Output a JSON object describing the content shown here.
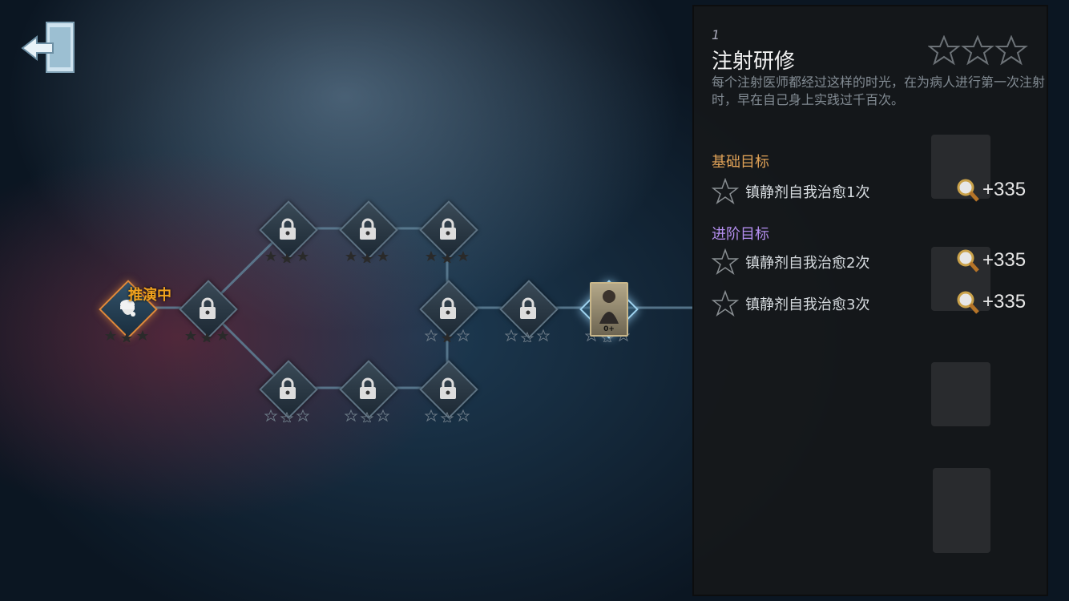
{
  "map": {
    "active_node_label": "推演中",
    "card_label": "0+"
  },
  "panel": {
    "level_index": "1",
    "title": "注射研修",
    "description": "每个注射医师都经过这样的时光，在为病人进行第一次注射时，早在自己身上实践过千百次。",
    "basic_section": "基础目标",
    "advanced_section": "进阶目标",
    "goals_basic": [
      {
        "text": "镇静剂自我治愈1次",
        "reward": "+335"
      }
    ],
    "goals_advanced": [
      {
        "text": "镇静剂自我治愈2次",
        "reward": "+335"
      },
      {
        "text": "镇静剂自我治愈3次",
        "reward": "+335"
      }
    ]
  },
  "colors": {
    "accent_orange": "#f0a11e",
    "basic": "#e0a257",
    "advanced": "#b58ff0"
  },
  "icons": [
    "back-door-icon",
    "lock-icon",
    "detective-icon",
    "star-icon",
    "magnifier-icon"
  ]
}
